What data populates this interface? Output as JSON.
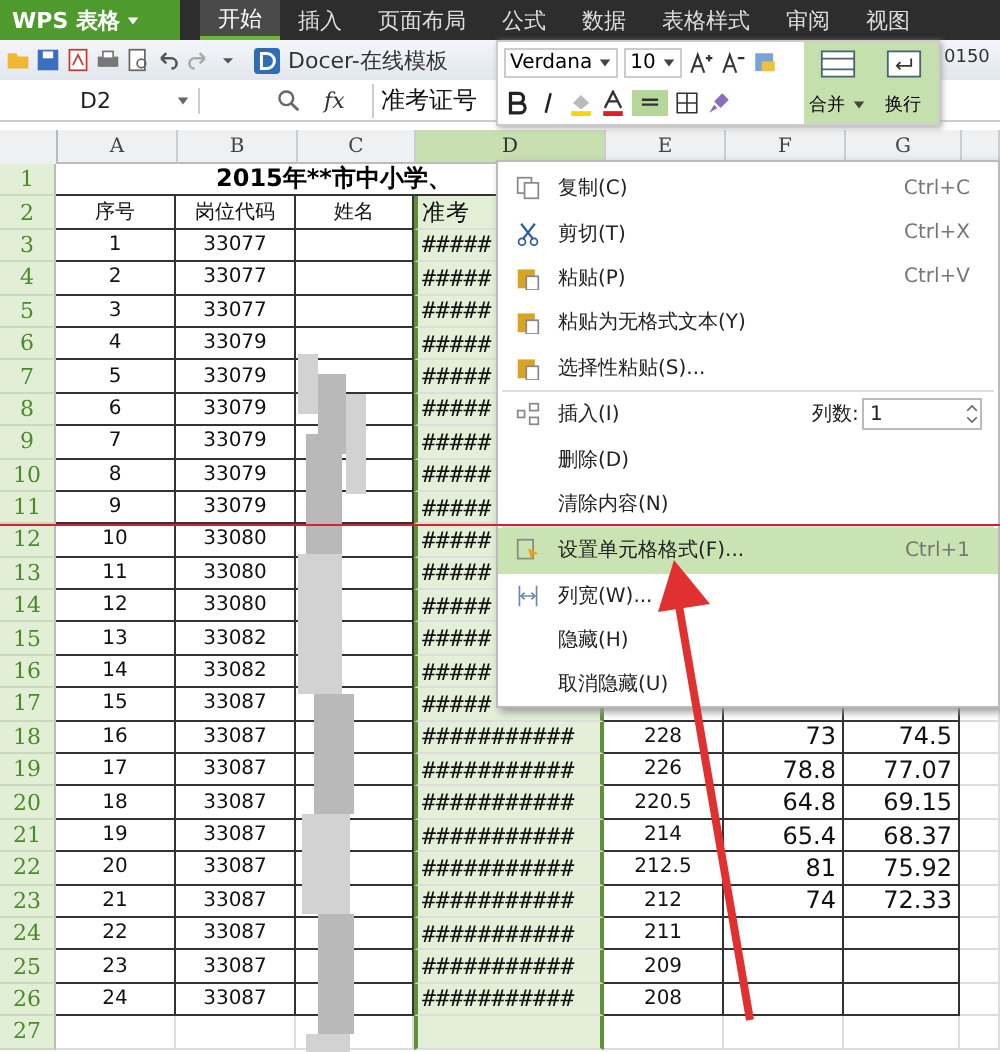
{
  "app": {
    "name": "WPS 表格"
  },
  "ribbon_tabs": [
    {
      "label": "开始",
      "selected": true
    },
    {
      "label": "插入",
      "selected": false
    },
    {
      "label": "页面布局",
      "selected": false
    },
    {
      "label": "公式",
      "selected": false
    },
    {
      "label": "数据",
      "selected": false
    },
    {
      "label": "表格样式",
      "selected": false
    },
    {
      "label": "审阅",
      "selected": false
    },
    {
      "label": "视图",
      "selected": false
    }
  ],
  "quick_toolbar": {
    "template_button": "Docer-在线模板",
    "cut_text": "0150"
  },
  "formula_bar": {
    "cell": "D2",
    "fx": "fx",
    "value": "准考证号"
  },
  "mini_toolbar": {
    "font": "Verdana",
    "size": "10",
    "merge": "合并",
    "wrap": "换行"
  },
  "sheet": {
    "columns": [
      {
        "label": "A",
        "selected": false
      },
      {
        "label": "B",
        "selected": false
      },
      {
        "label": "C",
        "selected": false
      },
      {
        "label": "D",
        "selected": true
      },
      {
        "label": "E",
        "selected": false
      },
      {
        "label": "F",
        "selected": false
      },
      {
        "label": "G",
        "selected": false
      }
    ],
    "title_row": "1",
    "title": "2015年**市中小学、",
    "rows": [
      {
        "row": "2",
        "a": "序号",
        "b": "岗位代码",
        "c": "姓名",
        "d": "准考"
      },
      {
        "row": "3",
        "a": "1",
        "b": "33077",
        "d": "#####"
      },
      {
        "row": "4",
        "a": "2",
        "b": "33077",
        "d": "#####"
      },
      {
        "row": "5",
        "a": "3",
        "b": "33077",
        "d": "#####"
      },
      {
        "row": "6",
        "a": "4",
        "b": "33079",
        "d": "#####"
      },
      {
        "row": "7",
        "a": "5",
        "b": "33079",
        "d": "#####"
      },
      {
        "row": "8",
        "a": "6",
        "b": "33079",
        "d": "#####"
      },
      {
        "row": "9",
        "a": "7",
        "b": "33079",
        "d": "#####"
      },
      {
        "row": "10",
        "a": "8",
        "b": "33079",
        "d": "#####"
      },
      {
        "row": "11",
        "a": "9",
        "b": "33079",
        "d": "#####"
      },
      {
        "row": "12",
        "a": "10",
        "b": "33080",
        "d": "#####"
      },
      {
        "row": "13",
        "a": "11",
        "b": "33080",
        "d": "#####"
      },
      {
        "row": "14",
        "a": "12",
        "b": "33080",
        "d": "#####"
      },
      {
        "row": "15",
        "a": "13",
        "b": "33082",
        "d": "#####"
      },
      {
        "row": "16",
        "a": "14",
        "b": "33082",
        "d": "#####"
      },
      {
        "row": "17",
        "a": "15",
        "b": "33087",
        "d": "#####"
      },
      {
        "row": "18",
        "a": "16",
        "b": "33087",
        "d": "###########",
        "e": "228",
        "f": "73",
        "g": "74.5"
      },
      {
        "row": "19",
        "a": "17",
        "b": "33087",
        "d": "###########",
        "e": "226",
        "f": "78.8",
        "g": "77.07"
      },
      {
        "row": "20",
        "a": "18",
        "b": "33087",
        "d": "###########",
        "e": "220.5",
        "f": "64.8",
        "g": "69.15"
      },
      {
        "row": "21",
        "a": "19",
        "b": "33087",
        "d": "###########",
        "e": "214",
        "f": "65.4",
        "g": "68.37"
      },
      {
        "row": "22",
        "a": "20",
        "b": "33087",
        "d": "###########",
        "e": "212.5",
        "f": "81",
        "g": "75.92"
      },
      {
        "row": "23",
        "a": "21",
        "b": "33087",
        "d": "###########",
        "e": "212",
        "f": "74",
        "g": "72.33"
      },
      {
        "row": "24",
        "a": "22",
        "b": "33087",
        "d": "###########",
        "e": "211"
      },
      {
        "row": "25",
        "a": "23",
        "b": "33087",
        "d": "###########",
        "e": "209"
      },
      {
        "row": "26",
        "a": "24",
        "b": "33087",
        "d": "###########",
        "e": "208"
      },
      {
        "row": "27"
      }
    ]
  },
  "context_menu": {
    "items": [
      {
        "kind": "copy",
        "label": "复制(C)",
        "shortcut": "Ctrl+C",
        "selected": false
      },
      {
        "kind": "cut",
        "label": "剪切(T)",
        "shortcut": "Ctrl+X",
        "selected": false
      },
      {
        "kind": "paste",
        "label": "粘贴(P)",
        "shortcut": "Ctrl+V",
        "selected": false
      },
      {
        "kind": "paste",
        "label": "粘贴为无格式文本(Y)",
        "selected": false
      },
      {
        "kind": "paste",
        "label": "选择性粘贴(S)...",
        "selected": false,
        "separator_after": true
      },
      {
        "kind": "insert",
        "label": "插入(I)",
        "count_label": "列数:",
        "count": "1",
        "selected": false
      },
      {
        "kind": "plain",
        "label": "删除(D)",
        "selected": false
      },
      {
        "kind": "plain",
        "label": "清除内容(N)",
        "selected": false,
        "separator_after": true
      },
      {
        "kind": "format",
        "label": "设置单元格格式(F)...",
        "shortcut": "Ctrl+1",
        "selected": true
      },
      {
        "kind": "width",
        "label": "列宽(W)...",
        "selected": false
      },
      {
        "kind": "plain",
        "label": "隐藏(H)",
        "selected": false
      },
      {
        "kind": "plain",
        "label": "取消隐藏(U)",
        "selected": false
      }
    ]
  }
}
